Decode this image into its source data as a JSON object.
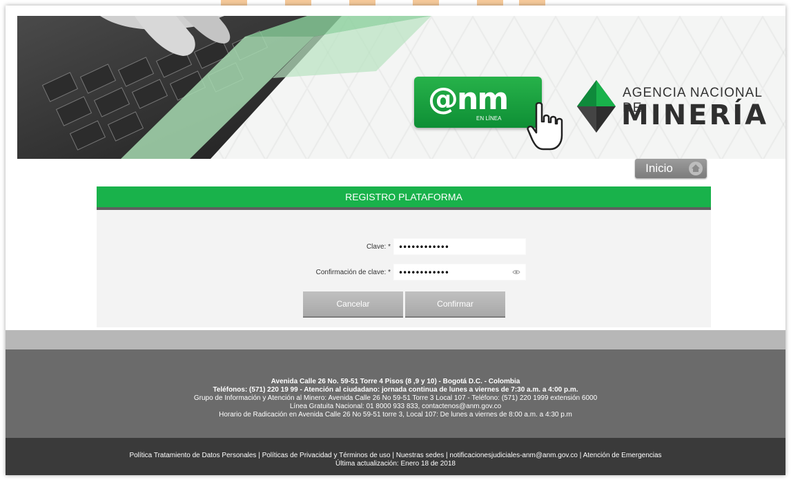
{
  "header": {
    "anm_logo_text": "@nm",
    "anm_logo_sub": "EN LÍNEA",
    "agency_line1": "AGENCIA NACIONAL DE",
    "agency_line2": "MINERÍA"
  },
  "nav": {
    "inicio_label": "Inicio"
  },
  "form": {
    "title": "REGISTRO PLATAFORMA",
    "clave_label": "Clave:",
    "clave_value": "••••••••••••",
    "confirm_label": "Confirmación de clave:",
    "confirm_value": "••••••••••••",
    "required_mark": "*",
    "cancel_label": "Cancelar",
    "confirm_button_label": "Confirmar"
  },
  "footer": {
    "line1": "Avenida Calle 26 No. 59-51 Torre 4 Pisos (8 ,9 y 10) - Bogotá D.C. - Colombia",
    "line2": "Teléfonos: (571) 220 19 99 - Atención al ciudadano: jornada continua de lunes a viernes de 7:30 a.m. a 4:00 p.m.",
    "line3": "Grupo de Información y Atención al Minero: Avenida Calle 26 No 59-51 Torre 3 Local 107 - Teléfono: (571) 220 1999 extensión 6000",
    "line4": "Línea Gratuita Nacional: 01 8000 933 833, contactenos@anm.gov.co",
    "line5": "Horario de Radicación en Avenida Calle 26 No 59-51 torre 3, Local 107: De lunes a viernes de 8:00 a.m. a 4:30 p.m",
    "links_line": "Política Tratamiento de Datos Personales | Políticas de Privacidad y Términos de uso | Nuestras sedes | notificacionesjudiciales-anm@anm.gov.co | Atención de Emergencias",
    "updated": "Última actualización: Enero 18 de 2018"
  },
  "colors": {
    "brand_green": "#19b24b",
    "footer_dark": "#3a3a3a",
    "footer_mid": "#6b6b6b"
  }
}
